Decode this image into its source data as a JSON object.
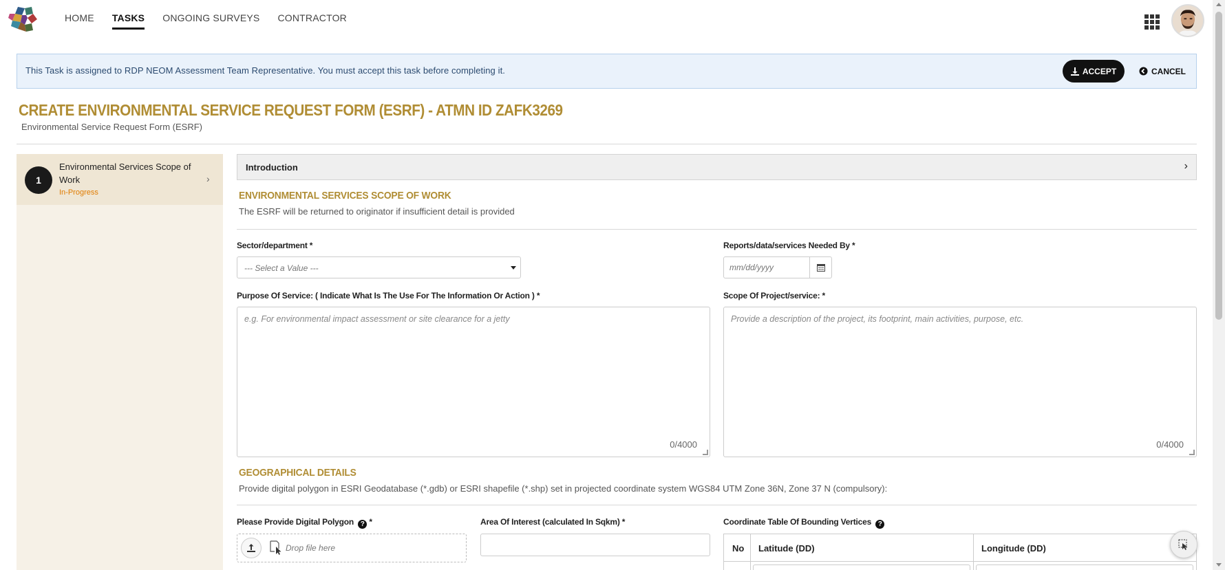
{
  "nav": {
    "items": [
      {
        "label": "HOME",
        "active": false
      },
      {
        "label": "TASKS",
        "active": true
      },
      {
        "label": "ONGOING SURVEYS",
        "active": false
      },
      {
        "label": "CONTRACTOR",
        "active": false
      }
    ],
    "apps_icon": "grid-apps-icon",
    "avatar_icon": "user-avatar"
  },
  "banner": {
    "message": "This Task is assigned to RDP NEOM Assessment Team Representative. You must accept this task before completing it.",
    "accept_label": "ACCEPT",
    "cancel_label": "CANCEL",
    "accept_icon": "download-icon",
    "cancel_icon": "back-circle-icon"
  },
  "page": {
    "title": "CREATE ENVIRONMENTAL SERVICE REQUEST FORM (ESRF) - ATMN ID ZAFK3269",
    "subtitle": "Environmental Service Request Form (ESRF)"
  },
  "sidebar": {
    "steps": [
      {
        "number": "1",
        "label": "Environmental Services Scope of Work",
        "status": "In-Progress"
      }
    ]
  },
  "intro": {
    "label": "Introduction"
  },
  "scope_section": {
    "title": "ENVIRONMENTAL SERVICES SCOPE OF WORK",
    "description": "The ESRF will be returned to originator if insufficient detail is provided"
  },
  "fields": {
    "sector": {
      "label": "Sector/department *",
      "value": "--- Select a Value ---"
    },
    "needed_by": {
      "label": "Reports/data/services Needed By *",
      "placeholder": "mm/dd/yyyy"
    },
    "purpose": {
      "label": "Purpose Of Service: ( Indicate What Is The Use For The Information Or Action ) *",
      "placeholder": "e.g. For environmental impact assessment or site clearance for a jetty",
      "counter": "0/4000"
    },
    "scope": {
      "label": "Scope Of Project/service: *",
      "placeholder": "Provide a description of the project, its footprint, main activities, purpose, etc.",
      "counter": "0/4000"
    }
  },
  "geo_section": {
    "title": "GEOGRAPHICAL DETAILS",
    "description": "Provide digital polygon in ESRI Geodatabase (*.gdb) or ESRI shapefile (*.shp)  set in projected coordinate system WGS84 UTM Zone 36N, Zone 37 N (compulsory):"
  },
  "geo_fields": {
    "polygon": {
      "label": "Please Provide Digital Polygon",
      "required_mark": "*",
      "drop_text": "Drop file here"
    },
    "area": {
      "label": "Area Of Interest (calculated In Sqkm) *"
    },
    "coords": {
      "label": "Coordinate Table Of Bounding Vertices",
      "columns": [
        "No",
        "Latitude (DD)",
        "Longitude (DD)"
      ]
    }
  },
  "colors": {
    "accent_gold": "#b08d34",
    "banner_bg": "#eaf2fb",
    "status_orange": "#e07b00",
    "sidebar_bg": "#f6f1e7"
  }
}
